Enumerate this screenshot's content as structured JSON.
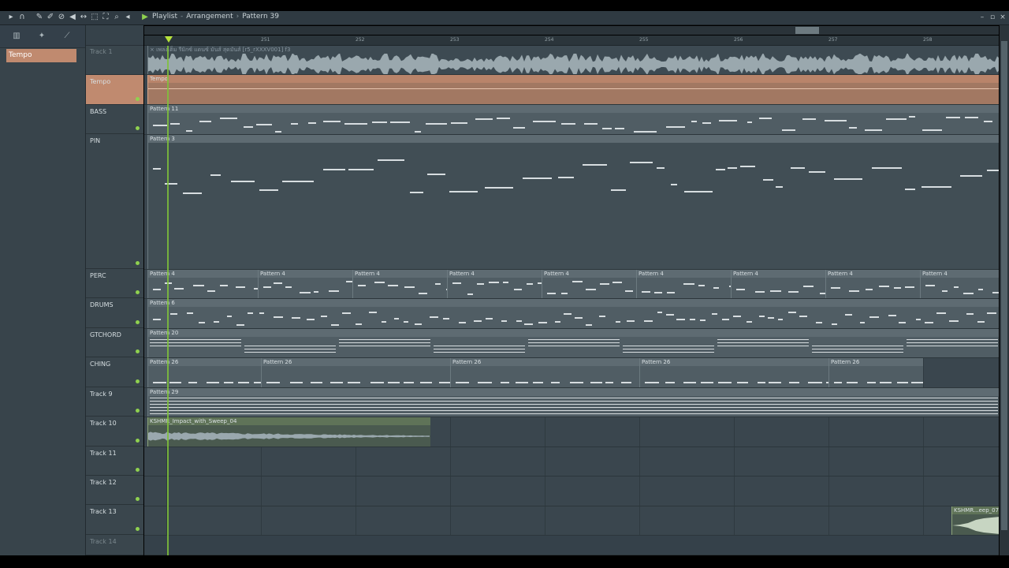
{
  "window": {
    "title_parts": [
      "Playlist",
      "Arrangement",
      "Pattern 39"
    ],
    "icons": [
      "menu-arrow-icon",
      "magnet-icon",
      "pencil-icon",
      "paint-icon",
      "delete-icon",
      "mute-icon",
      "slip-icon",
      "select-icon",
      "zoom-icon",
      "playback-icon"
    ]
  },
  "browser": {
    "selected_item": "Tempo"
  },
  "ruler": {
    "bars": [
      "251",
      "252",
      "253",
      "254",
      "255",
      "256",
      "257",
      "258"
    ]
  },
  "tracks": [
    {
      "name": "Track 1",
      "clip": "× เพลงเต็ม รีมิกซ์ แดนซ์ มันส์ สุดมันส์ [r5_rXXXV001] f3"
    },
    {
      "name": "Tempo",
      "clip": "Tempo"
    },
    {
      "name": "BASS",
      "clip": "Pattern 11"
    },
    {
      "name": "PIN",
      "clip": "Pattern 3"
    },
    {
      "name": "PERC",
      "clip": "Pattern 4"
    },
    {
      "name": "DRUMS",
      "clip": "Pattern 6"
    },
    {
      "name": "GTCHORD",
      "clip": "Pattern 20"
    },
    {
      "name": "CHING",
      "clip": "Pattern 26"
    },
    {
      "name": "Track 9",
      "clip": "Pattern 29"
    },
    {
      "name": "Track 10",
      "clip": "KSHMR_Impact_with_Sweep_04"
    },
    {
      "name": "Track 11",
      "clip": ""
    },
    {
      "name": "Track 12",
      "clip": ""
    },
    {
      "name": "Track 13",
      "clip": "KSHMR...eep_07"
    },
    {
      "name": "Track 14",
      "clip": ""
    }
  ],
  "colors": {
    "tempo": "#c08a6f",
    "playhead": "#7fc23a",
    "clip": "#505d64"
  }
}
